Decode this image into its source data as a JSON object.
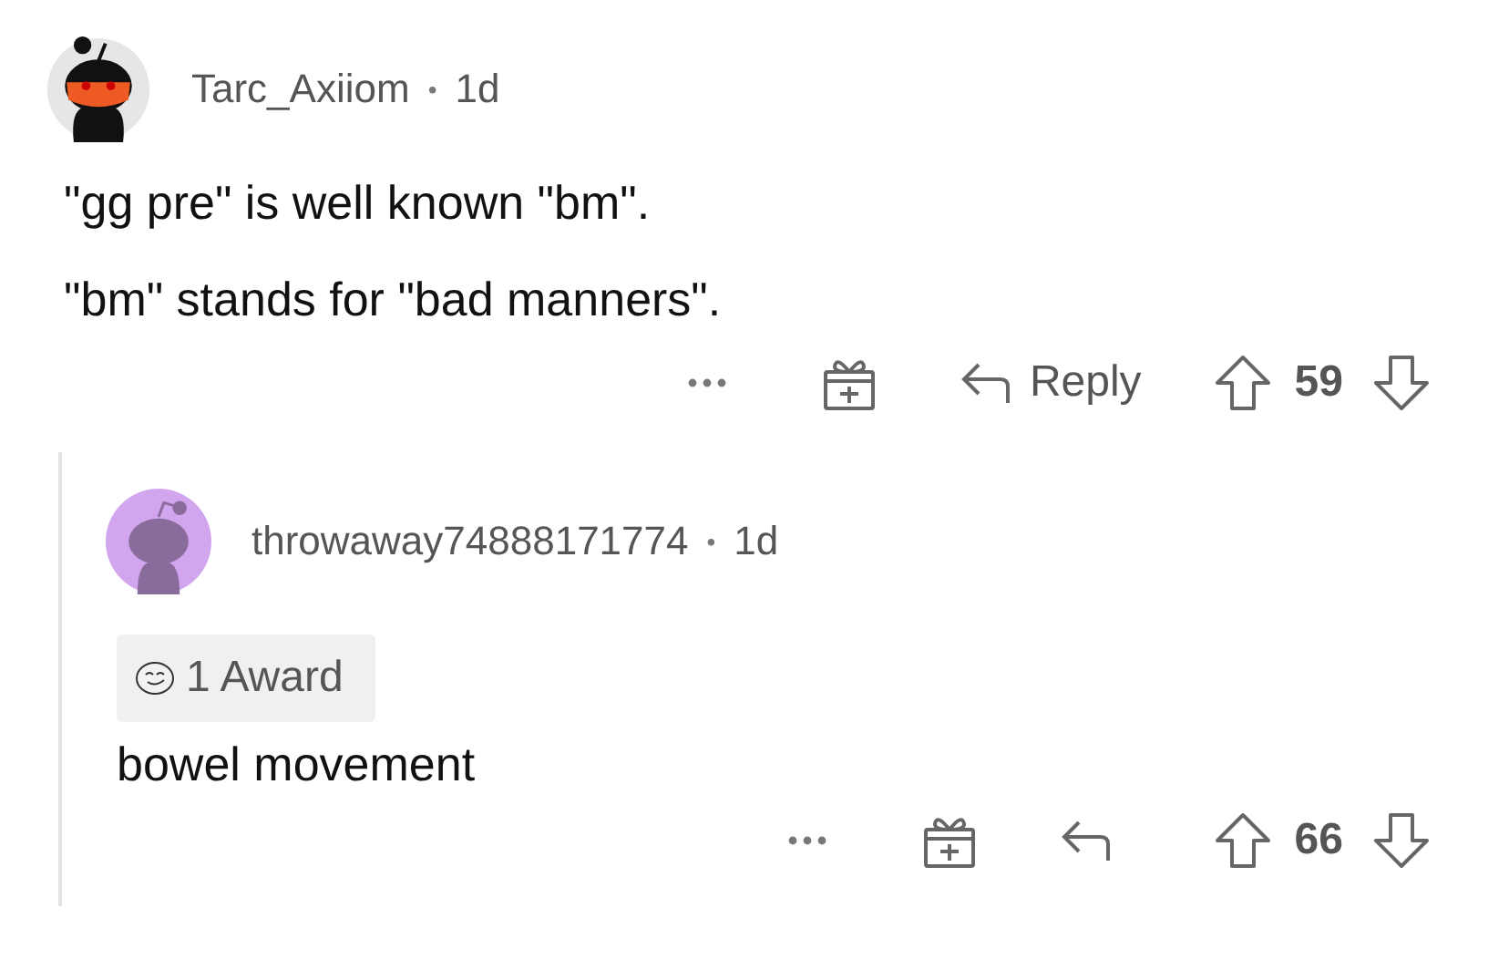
{
  "comments": [
    {
      "author": "Tarc_Axiiom",
      "separator": "•",
      "age": "1d",
      "avatar": {
        "kind": "masked"
      },
      "body": [
        "\"gg pre\" is well known \"bm\".",
        "\"bm\" stands for \"bad manners\"."
      ],
      "actions": {
        "reply_label": "Reply",
        "score": "59"
      },
      "children": [
        {
          "author": "throwaway74888171774",
          "separator": "•",
          "age": "1d",
          "avatar": {
            "kind": "plain"
          },
          "award": "1 Award",
          "body": [
            "bowel movement"
          ],
          "actions": {
            "score": "66"
          }
        }
      ]
    }
  ]
}
